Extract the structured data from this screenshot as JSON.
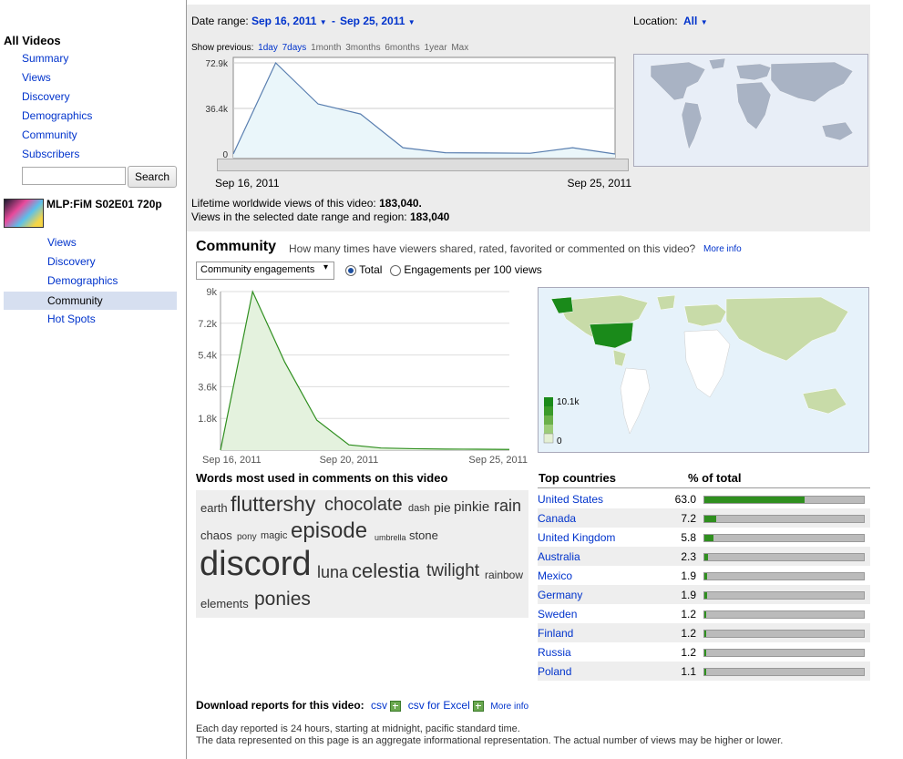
{
  "sidebar": {
    "title": "All Videos",
    "links": [
      "Summary",
      "Views",
      "Discovery",
      "Demographics",
      "Community",
      "Subscribers"
    ],
    "search_button": "Search",
    "search_value": "",
    "video_title": "MLP:FiM S02E01 720p",
    "video_links": [
      "Views",
      "Discovery",
      "Demographics",
      "Community",
      "Hot Spots"
    ],
    "active_video_link": "Community"
  },
  "header": {
    "date_range_label": "Date range:",
    "date_from": "Sep 16, 2011",
    "date_sep": "-",
    "date_to": "Sep 25, 2011",
    "location_label": "Location:",
    "location_value": "All",
    "show_previous_label": "Show previous:",
    "show_previous_options": [
      "1day",
      "7days",
      "1month",
      "3months",
      "6months",
      "1year",
      "Max"
    ],
    "lifetime_label": "Lifetime worldwide views of this video:",
    "lifetime_value": "183,040.",
    "range_label": "Views in the selected date range and region:",
    "range_value": "183,040"
  },
  "chart_data": [
    {
      "type": "line",
      "y_ticks": [
        "72.9k",
        "36.4k",
        "0"
      ],
      "x_tick_labels": [
        "Sep 16, 2011",
        "Sep 25, 2011"
      ],
      "x": [
        "Sep 16, 2011",
        "Sep 17, 2011",
        "Sep 18, 2011",
        "Sep 19, 2011",
        "Sep 20, 2011",
        "Sep 21, 2011",
        "Sep 22, 2011",
        "Sep 23, 2011",
        "Sep 24, 2011",
        "Sep 25, 2011"
      ],
      "values": [
        0,
        72900,
        40000,
        32000,
        5000,
        1000,
        800,
        600,
        5000,
        0
      ],
      "ylim": [
        0,
        72900
      ]
    },
    {
      "type": "area",
      "y_ticks": [
        "9k",
        "7.2k",
        "5.4k",
        "3.6k",
        "1.8k"
      ],
      "x_tick_labels": [
        "Sep 16, 2011",
        "Sep 20, 2011",
        "Sep 25, 2011"
      ],
      "x": [
        "Sep 16, 2011",
        "Sep 17, 2011",
        "Sep 18, 2011",
        "Sep 19, 2011",
        "Sep 20, 2011",
        "Sep 21, 2011",
        "Sep 22, 2011",
        "Sep 23, 2011",
        "Sep 24, 2011",
        "Sep 25, 2011"
      ],
      "values": [
        0,
        9000,
        5000,
        1700,
        300,
        120,
        80,
        60,
        50,
        40
      ],
      "ylim": [
        0,
        9000
      ],
      "color": "#2f8f1f"
    }
  ],
  "community": {
    "title": "Community",
    "question": "How many times have viewers shared, rated, favorited or commented on this video?",
    "more_info": "More info",
    "select_value": "Community engagements",
    "radio_total": "Total",
    "radio_per100": "Engagements per 100 views",
    "legend_max": "10.1k",
    "legend_min": "0"
  },
  "words": {
    "title": "Words most used in comments on this video",
    "items": [
      "earth",
      "fluttershy",
      "chocolate",
      "dash",
      "pie",
      "pinkie",
      "rain",
      "chaos",
      "pony",
      "magic",
      "episode",
      "umbrella",
      "stone",
      "discord",
      "luna",
      "celestia",
      "twilight",
      "rainbow",
      "elements",
      "ponies"
    ]
  },
  "countries": {
    "col_country": "Top countries",
    "col_pct": "% of total",
    "rows": [
      {
        "name": "United States",
        "pct": "63.0",
        "value": 63.0
      },
      {
        "name": "Canada",
        "pct": "7.2",
        "value": 7.2
      },
      {
        "name": "United Kingdom",
        "pct": "5.8",
        "value": 5.8
      },
      {
        "name": "Australia",
        "pct": "2.3",
        "value": 2.3
      },
      {
        "name": "Mexico",
        "pct": "1.9",
        "value": 1.9
      },
      {
        "name": "Germany",
        "pct": "1.9",
        "value": 1.9
      },
      {
        "name": "Sweden",
        "pct": "1.2",
        "value": 1.2
      },
      {
        "name": "Finland",
        "pct": "1.2",
        "value": 1.2
      },
      {
        "name": "Russia",
        "pct": "1.2",
        "value": 1.2
      },
      {
        "name": "Poland",
        "pct": "1.1",
        "value": 1.1
      }
    ]
  },
  "footer": {
    "download_label": "Download reports for this video:",
    "csv": "csv",
    "csv_excel": "csv for Excel",
    "more_info": "More info",
    "note1": "Each day reported is 24 hours, starting at midnight, pacific standard time.",
    "note2": "The data represented on this page is an aggregate informational representation. The actual number of views may be higher or lower."
  },
  "colors": {
    "link": "#0033cc",
    "accent_green": "#2f8f1f",
    "bar_gray": "#bbbbbb"
  }
}
